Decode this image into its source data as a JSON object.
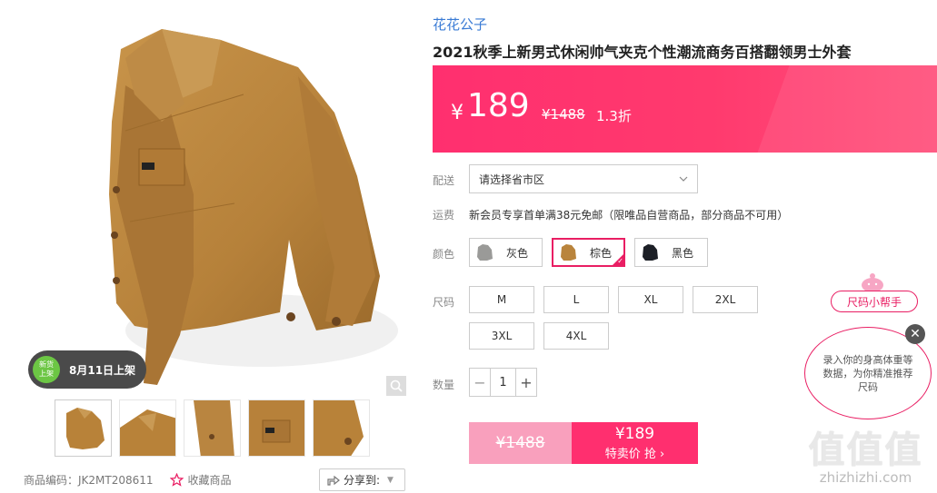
{
  "product": {
    "brand": "花花公子",
    "title": "2021秋季上新男式休闲帅气夹克个性潮流商务百搭翻领男士外套"
  },
  "price": {
    "currency": "¥",
    "current": "189",
    "original": "¥1488",
    "discount": "1.3折"
  },
  "badge": {
    "circle_line1": "新货",
    "circle_line2": "上架",
    "text": "8月11日上架"
  },
  "meta": {
    "sku_label": "商品编码：JK2MT208611",
    "favorite_label": "收藏商品",
    "share_label": "分享到:"
  },
  "labels": {
    "delivery": "配送",
    "shipping": "运费",
    "color": "颜色",
    "size": "尺码",
    "quantity": "数量"
  },
  "delivery": {
    "placeholder": "请选择省市区"
  },
  "shipping": {
    "text": "新会员专享首单满38元免邮（限唯品自营商品，部分商品不可用）"
  },
  "colors": [
    {
      "label": "灰色",
      "swatch": "#9a9a98",
      "selected": false
    },
    {
      "label": "棕色",
      "swatch": "#b9843c",
      "selected": true
    },
    {
      "label": "黑色",
      "swatch": "#1c1f26",
      "selected": false
    }
  ],
  "sizes": [
    "M",
    "L",
    "XL",
    "2XL",
    "3XL",
    "4XL"
  ],
  "quantity": {
    "minus": "−",
    "value": "1",
    "plus": "+"
  },
  "buy": {
    "old_price": "¥1488",
    "new_price": "¥189",
    "action": "特卖价 抢 ›"
  },
  "size_helper": {
    "title": "尺码小帮手",
    "body": "录入你的身高体重等数据，为你精准推荐尺码",
    "close": "✕"
  },
  "watermark": {
    "big": "值值值",
    "small": "zhizhizhi.com"
  },
  "colors_theme": {
    "accent": "#ff2f6f",
    "brand_link": "#3a7bd5",
    "jacket": "#b88239"
  }
}
